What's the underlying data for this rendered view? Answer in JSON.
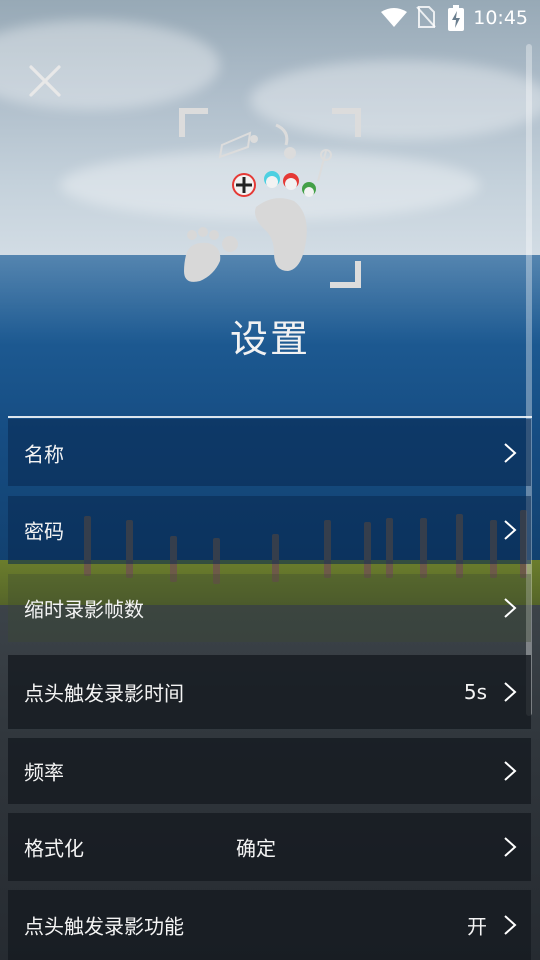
{
  "status_bar": {
    "time": "10:45"
  },
  "header": {
    "title": "设置"
  },
  "settings": {
    "name_label": "名称",
    "password_label": "密码",
    "timelapse_fps_label": "缩时录影帧数",
    "nod_record_time_label": "点头触发录影时间",
    "nod_record_time_value": "5s",
    "frequency_label": "频率",
    "format_label": "格式化",
    "format_value": "确定",
    "nod_record_feature_label": "点头触发录影功能",
    "nod_record_feature_value": "开"
  },
  "colors": {
    "logo_gray": "#d8d8d8",
    "dot_red": "#e53935",
    "dot_cyan": "#4dd0e1",
    "dot_green": "#43a047"
  }
}
